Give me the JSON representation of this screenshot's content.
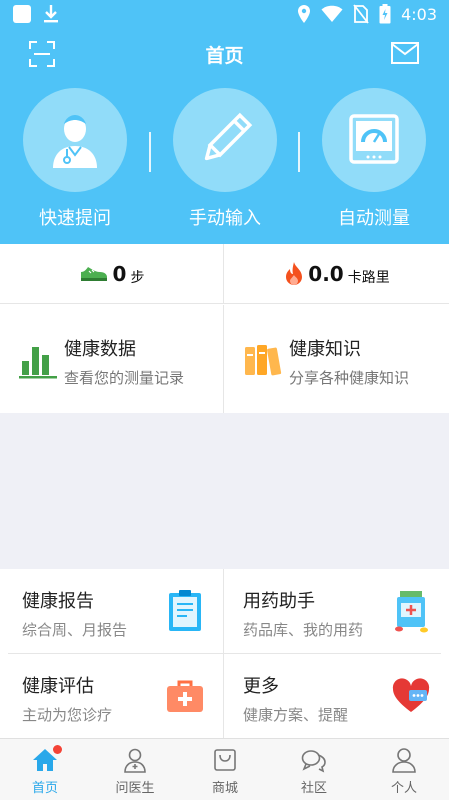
{
  "status_bar": {
    "time": "4:03"
  },
  "header": {
    "title": "首页",
    "actions": [
      {
        "label": "快速提问",
        "icon": "doctor-icon"
      },
      {
        "label": "手动输入",
        "icon": "pencil-icon"
      },
      {
        "label": "自动测量",
        "icon": "gauge-icon"
      }
    ]
  },
  "stats": {
    "steps_value": "0",
    "steps_unit": "步",
    "calories_value": "0.0",
    "calories_unit": "卡路里"
  },
  "features": [
    {
      "title": "健康数据",
      "subtitle": "查看您的测量记录",
      "icon": "bar-chart-icon"
    },
    {
      "title": "健康知识",
      "subtitle": "分享各种健康知识",
      "icon": "books-icon"
    }
  ],
  "grid": [
    {
      "title": "健康报告",
      "subtitle": "综合周、月报告",
      "icon": "report-icon"
    },
    {
      "title": "用药助手",
      "subtitle": "药品库、我的用药",
      "icon": "medicine-icon"
    },
    {
      "title": "健康评估",
      "subtitle": "主动为您诊疗",
      "icon": "first-aid-kit-icon"
    },
    {
      "title": "更多",
      "subtitle": "健康方案、提醒",
      "icon": "heart-icon"
    }
  ],
  "tabs": [
    {
      "label": "首页",
      "icon": "home-icon",
      "active": true
    },
    {
      "label": "问医生",
      "icon": "doctor-user-icon"
    },
    {
      "label": "商城",
      "icon": "shop-icon"
    },
    {
      "label": "社区",
      "icon": "chat-icon"
    },
    {
      "label": "个人",
      "icon": "person-icon"
    }
  ],
  "colors": {
    "header_bg": "#4fc3f7",
    "accent": "#29a8ea",
    "background_gap": "#eff0f6"
  }
}
